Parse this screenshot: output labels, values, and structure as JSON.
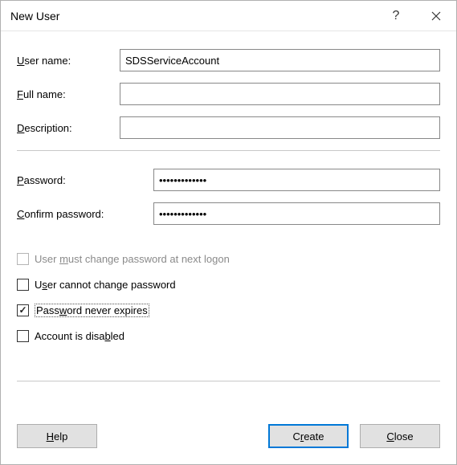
{
  "title": "New User",
  "labels": {
    "user_name": "ser name:",
    "full_name": "ull name:",
    "description": "escription:",
    "password": "assword:",
    "confirm_password": "onfirm password:"
  },
  "access_keys": {
    "user_name": "U",
    "full_name": "F",
    "description": "D",
    "password": "P",
    "confirm_password": "C",
    "must_change_u": "m",
    "cannot_change_u": "s",
    "never_expires_u": "w",
    "disabled_u": "b",
    "help_u": "H",
    "create_u": "r",
    "close_u": "C"
  },
  "fields": {
    "user_name": "SDSServiceAccount",
    "full_name": "",
    "description": "",
    "password": "•••••••••••••",
    "confirm_password": "•••••••••••••"
  },
  "checkboxes": {
    "must_change": {
      "pre": "User ",
      "post": "ust change password at next logon",
      "checked": false,
      "enabled": false
    },
    "cannot_change": {
      "pre": "U",
      "post": "er cannot change password",
      "checked": false,
      "enabled": true
    },
    "never_expires": {
      "pre": "Pass",
      "post": "ord never expires",
      "checked": true,
      "enabled": true,
      "focused": true
    },
    "disabled_acct": {
      "pre": "Account is disa",
      "post": "led",
      "checked": false,
      "enabled": true
    }
  },
  "buttons": {
    "help": "elp",
    "create_pre": "C",
    "create_post": "eate",
    "close": "lose"
  }
}
